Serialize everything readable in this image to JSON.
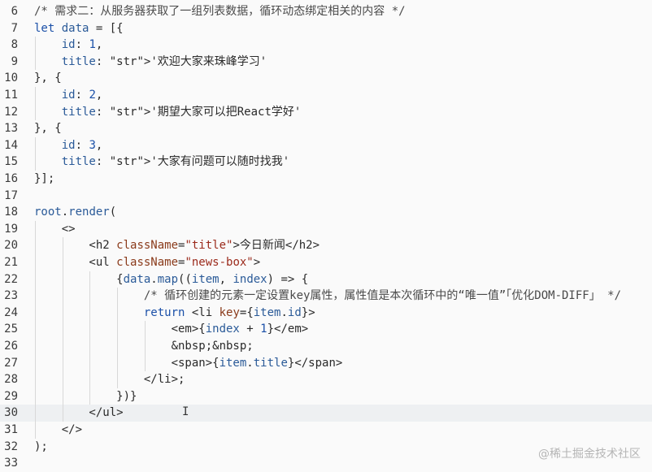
{
  "editor": {
    "current_line": 30,
    "lines": [
      {
        "n": "6",
        "text": "/* 需求二：从服务器获取了一组列表数据，循环动态绑定相关的内容 */"
      },
      {
        "n": "7",
        "text": "let data = [{"
      },
      {
        "n": "8",
        "text": "    id: 1,"
      },
      {
        "n": "9",
        "text": "    title: '欢迎大家来珠峰学习'"
      },
      {
        "n": "10",
        "text": "}, {"
      },
      {
        "n": "11",
        "text": "    id: 2,"
      },
      {
        "n": "12",
        "text": "    title: '期望大家可以把React学好'"
      },
      {
        "n": "13",
        "text": "}, {"
      },
      {
        "n": "14",
        "text": "    id: 3,"
      },
      {
        "n": "15",
        "text": "    title: '大家有问题可以随时找我'"
      },
      {
        "n": "16",
        "text": "}];"
      },
      {
        "n": "17",
        "text": ""
      },
      {
        "n": "18",
        "text": "root.render("
      },
      {
        "n": "19",
        "text": "    <>"
      },
      {
        "n": "20",
        "text": "        <h2 className=\"title\">今日新闻</h2>"
      },
      {
        "n": "21",
        "text": "        <ul className=\"news-box\">"
      },
      {
        "n": "22",
        "text": "            {data.map((item, index) => {"
      },
      {
        "n": "23",
        "text": "                /* 循环创建的元素一定设置key属性，属性值是本次循环中的“唯一值”「优化DOM-DIFF」 */"
      },
      {
        "n": "24",
        "text": "                return <li key={item.id}>"
      },
      {
        "n": "25",
        "text": "                    <em>{index + 1}</em>"
      },
      {
        "n": "26",
        "text": "                    &nbsp;&nbsp;"
      },
      {
        "n": "27",
        "text": "                    <span>{item.title}</span>"
      },
      {
        "n": "28",
        "text": "                </li>;"
      },
      {
        "n": "29",
        "text": "            })}"
      },
      {
        "n": "30",
        "text": "        </ul>"
      },
      {
        "n": "31",
        "text": "    </>"
      },
      {
        "n": "32",
        "text": ");"
      },
      {
        "n": "33",
        "text": ""
      }
    ]
  },
  "watermark": "@稀土掘金技术社区",
  "cursor_glyph": "I"
}
